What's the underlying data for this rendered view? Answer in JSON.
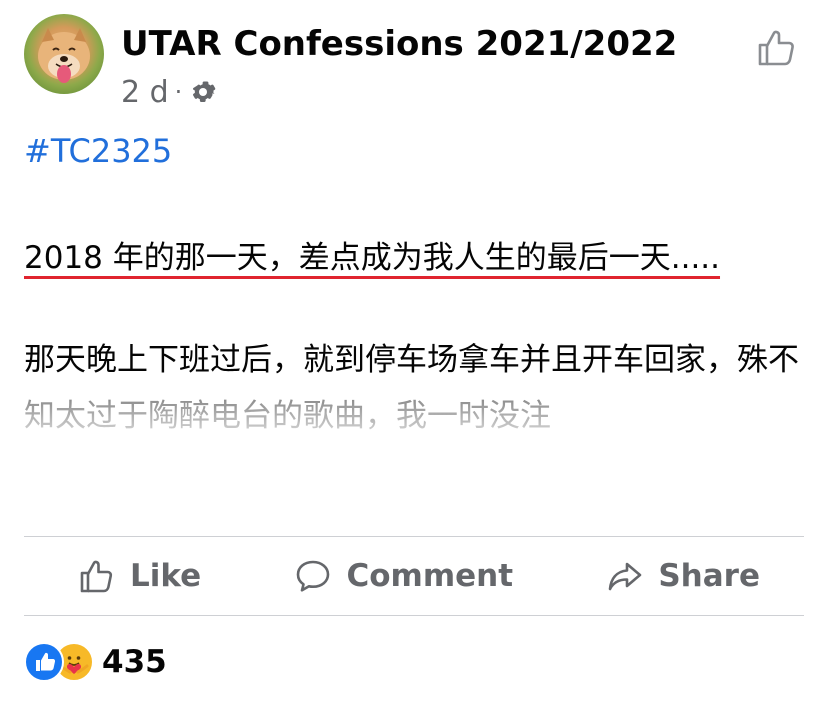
{
  "post": {
    "page_name": "UTAR Confessions 2021/2022",
    "time_ago": "2 d",
    "separator": "·",
    "privacy_icon": "gear-icon",
    "header_action_icon": "thumbs-up-outline-icon",
    "hashtag": "#TC2325",
    "paragraph_1": "2018 年的那一天，差点成为我人生的最后一天.....",
    "paragraph_2": "那天晚上下班过后，就到停车场拿车并且开车回家，殊不知太过于陶醉电台的歌曲，我一时没注"
  },
  "actions": {
    "like_label": "Like",
    "comment_label": "Comment",
    "share_label": "Share"
  },
  "reactions": {
    "count": "435",
    "icons": [
      "like-reaction-icon",
      "care-reaction-icon"
    ]
  },
  "colors": {
    "hashtag": "#216fdb",
    "underline": "#e0242f",
    "muted_text": "#65676b",
    "like_blue": "#1877f2",
    "care_yellow": "#f7b928"
  }
}
